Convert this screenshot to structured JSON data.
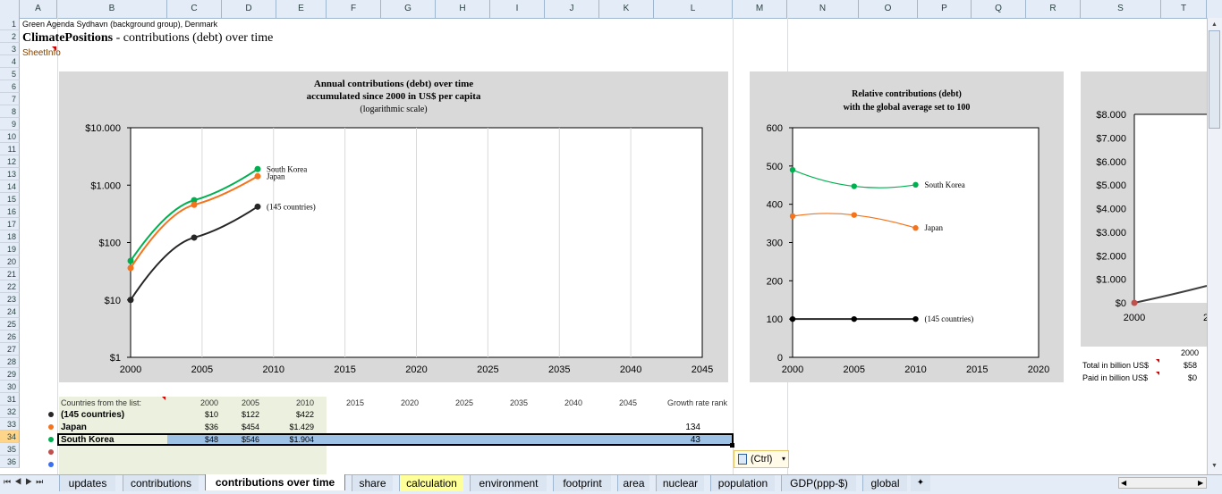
{
  "columns": [
    "A",
    "B",
    "C",
    "D",
    "E",
    "F",
    "G",
    "H",
    "I",
    "J",
    "K",
    "L",
    "M",
    "N",
    "O",
    "P",
    "Q",
    "R",
    "S",
    "T"
  ],
  "rows": [
    "1",
    "2",
    "3",
    "4",
    "5",
    "6",
    "7",
    "8",
    "9",
    "10",
    "11",
    "12",
    "13",
    "14",
    "15",
    "16",
    "17",
    "18",
    "19",
    "20",
    "21",
    "22",
    "23",
    "24",
    "25",
    "26",
    "27",
    "28",
    "29",
    "30",
    "31",
    "32",
    "33",
    "34",
    "35",
    "36"
  ],
  "sheet": {
    "org_line": "Green Agenda Sydhavn (background group), Denmark",
    "title_bold": "ClimatePositions",
    "title_rest": " - contributions (debt) over time",
    "sheetinfo": "SheetInfo"
  },
  "chart1": {
    "title_line1": "Annual contributions (debt) over time",
    "title_line2": "accumulated since 2000 in US$ per capita",
    "title_line3": "(logarithmic  scale)",
    "y_ticks": [
      "$10.000",
      "$1.000",
      "$100",
      "$10",
      "$1"
    ],
    "x_ticks": [
      "2000",
      "2005",
      "2010",
      "2015",
      "2020",
      "2025",
      "2035",
      "2040",
      "2045"
    ],
    "labels": {
      "korea": "South Korea",
      "japan": "Japan",
      "avg": "(145 countries)"
    }
  },
  "chart2": {
    "title_line1": "Relative contributions  (debt)",
    "title_line2": "with the global average  set to 100",
    "y_ticks": [
      "600",
      "500",
      "400",
      "300",
      "200",
      "100",
      "0"
    ],
    "x_ticks": [
      "2000",
      "2005",
      "2010",
      "2015",
      "2020"
    ],
    "labels": {
      "korea": "South Korea",
      "japan": "Japan",
      "avg": "(145 countries)"
    }
  },
  "chart3": {
    "y_ticks": [
      "$8.000",
      "$7.000",
      "$6.000",
      "$5.000",
      "$4.000",
      "$3.000",
      "$2.000",
      "$1.000",
      "$0"
    ],
    "x_ticks": [
      "2000",
      "2"
    ]
  },
  "side_table": {
    "year": "2000",
    "rows": [
      {
        "label": "Total in billion US$",
        "value": "$58"
      },
      {
        "label": "Paid in billion US$",
        "value": "$0"
      }
    ]
  },
  "table": {
    "header_label": "Countries from the list:",
    "years": [
      "2000",
      "2005",
      "2010",
      "2015",
      "2020",
      "2025",
      "2035",
      "2040",
      "2045"
    ],
    "rank_header": "Growth rate rank",
    "rows": [
      {
        "name": "(145 countries)",
        "values": [
          "$10",
          "$122",
          "$422"
        ],
        "rank": ""
      },
      {
        "name": "Japan",
        "values": [
          "$36",
          "$454",
          "$1.429"
        ],
        "rank": "134"
      },
      {
        "name": "South Korea",
        "values": [
          "$48",
          "$546",
          "$1.904"
        ],
        "rank": "43"
      }
    ]
  },
  "paste_button": "(Ctrl)",
  "tabs": [
    "updates",
    "contributions",
    "contributions over time",
    "share",
    "calculation",
    "environment",
    "footprint",
    "area",
    "nuclear",
    "population",
    "GDP(ppp-$)",
    "global"
  ],
  "active_tab": "contributions over time",
  "colors": {
    "korea": "#00b050",
    "japan": "#f4731c",
    "avg": "#262626",
    "chart_bg": "#d9d9d9",
    "header_bg": "#e4ecf7",
    "selection": "#9ec2e6"
  },
  "chart_data": [
    {
      "type": "line",
      "title": "Annual contributions (debt) over time accumulated since 2000 in US$ per capita (logarithmic scale)",
      "x": [
        2000,
        2005,
        2010
      ],
      "y_scale": "log",
      "ylim": [
        1,
        10000
      ],
      "xlim": [
        2000,
        2045
      ],
      "series": [
        {
          "name": "South Korea",
          "values": [
            48,
            546,
            1904
          ]
        },
        {
          "name": "Japan",
          "values": [
            36,
            454,
            1429
          ]
        },
        {
          "name": "(145 countries)",
          "values": [
            10,
            122,
            422
          ]
        }
      ]
    },
    {
      "type": "line",
      "title": "Relative contributions (debt) with the global average set to 100",
      "x": [
        2000,
        2005,
        2010
      ],
      "ylim": [
        0,
        600
      ],
      "xlim": [
        2000,
        2020
      ],
      "series": [
        {
          "name": "South Korea",
          "values": [
            490,
            447,
            451
          ]
        },
        {
          "name": "Japan",
          "values": [
            369,
            372,
            338
          ]
        },
        {
          "name": "(145 countries)",
          "values": [
            100,
            100,
            100
          ]
        }
      ]
    }
  ]
}
